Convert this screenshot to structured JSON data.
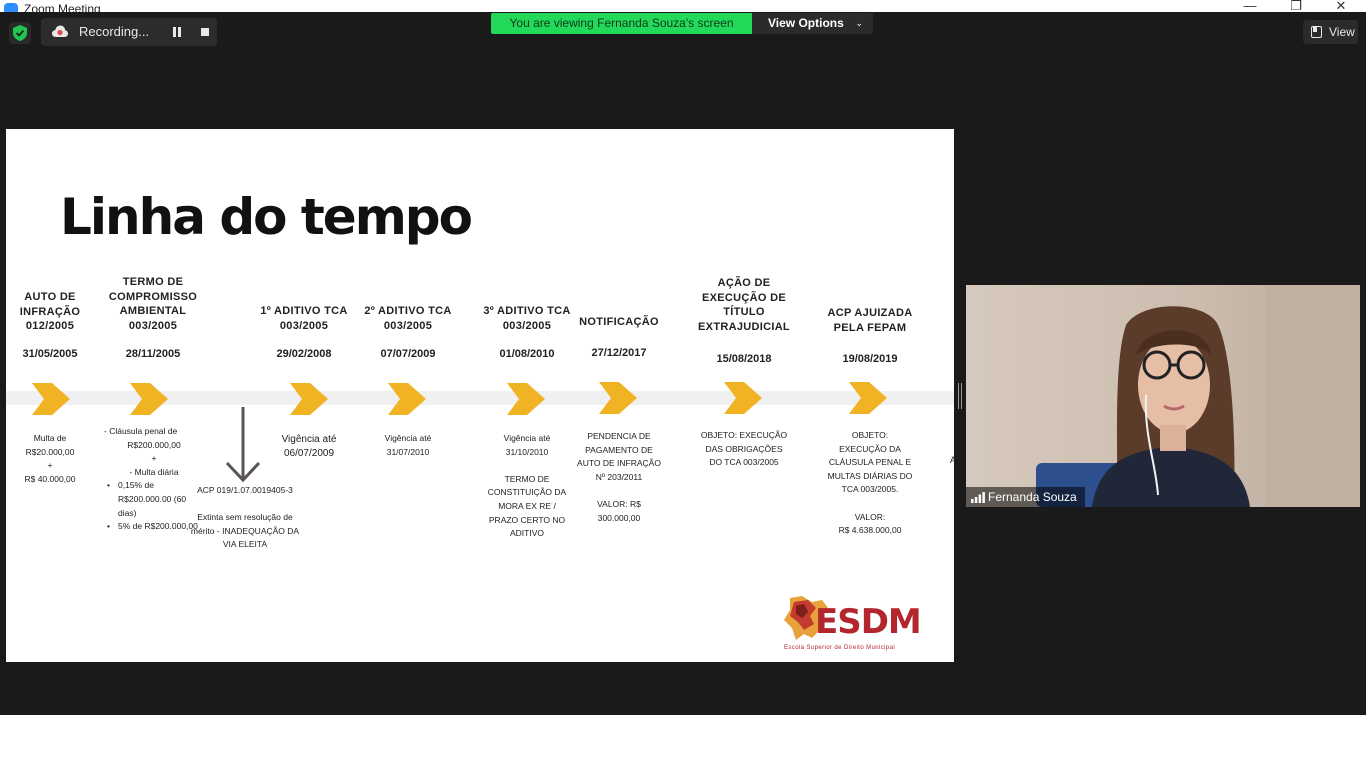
{
  "window": {
    "title": "Zoom Meeting"
  },
  "toolbar": {
    "recording_label": "Recording...",
    "viewing_banner": "You are viewing Fernanda Souza's screen",
    "view_options_label": "View Options",
    "view_label": "View"
  },
  "slide": {
    "title": "Linha do tempo",
    "events": [
      {
        "head": [
          "AUTO DE",
          "INFRAÇÃO",
          "012/2005"
        ],
        "date": "31/05/2005",
        "desc": [
          "Multa de",
          "R$20.000,00",
          "+",
          "R$ 40.000,00"
        ]
      },
      {
        "head": [
          "TERMO DE",
          "COMPROMISSO",
          "AMBIENTAL",
          "003/2005"
        ],
        "date": "28/11/2005",
        "desc": [
          "- Cláusula penal de",
          "R$200.000,00",
          "+",
          "- Multa diária"
        ],
        "bullets": [
          "0,15% de R$200.000.00 (60 dias)",
          "5% de R$200.000,00"
        ]
      },
      {
        "head": [
          "1º ADITIVO TCA",
          "003/2005"
        ],
        "date": "29/02/2008",
        "desc": [
          "Vigência até",
          "06/07/2009"
        ]
      },
      {
        "head": [
          "2º ADITIVO TCA",
          "003/2005"
        ],
        "date": "07/07/2009",
        "desc": [
          "Vigência até",
          "31/07/2010"
        ]
      },
      {
        "head": [
          "3º ADITIVO TCA",
          "003/2005"
        ],
        "date": "01/08/2010",
        "desc": [
          "Vigência até",
          "31/10/2010",
          "",
          "TERMO DE",
          "CONSTITUIÇÃO DA",
          "MORA EX RE /",
          "PRAZO CERTO NO",
          "ADITIVO"
        ]
      },
      {
        "head": [
          "NOTIFICAÇÃO"
        ],
        "date": "27/12/2017",
        "desc": [
          "PENDENCIA DE",
          "PAGAMENTO DE",
          "AUTO DE INFRAÇÃO",
          "Nº 203/2011",
          "",
          "VALOR: R$",
          "300.000,00"
        ]
      },
      {
        "head": [
          "AÇÃO DE",
          "EXECUÇÃO DE",
          "TÍTULO",
          "EXTRAJUDICIAL"
        ],
        "date": "15/08/2018",
        "desc": [
          "OBJETO: EXECUÇÃO",
          "DAS OBRIGAÇÕES",
          "DO TCA 003/2005"
        ]
      },
      {
        "head": [
          "ACP AJUIZADA",
          "PELA FEPAM"
        ],
        "date": "19/08/2019",
        "desc": [
          "OBJETO:",
          "EXECUÇÃO DA",
          "CLÁUSULA PENAL E",
          "MULTAS DIÁRIAS DO",
          "TCA 003/2005.",
          "",
          "VALOR:",
          "R$ 4.638.000,00"
        ]
      }
    ],
    "acp": {
      "number": "ACP 019/1.07.0019405-3",
      "note": [
        "Extinta sem resolução de",
        "mérito - INADEQUAÇÃO DA",
        "VIA ELEITA"
      ]
    },
    "edge_letter": "A",
    "logo": {
      "text": "ESDM",
      "subtitle": "Escola Superior de Direito Municipal"
    }
  },
  "participant": {
    "name": "Fernanda Souza"
  },
  "colors": {
    "arrow": "#f0b323",
    "banner": "#23d959",
    "logo": "#b3262d"
  }
}
